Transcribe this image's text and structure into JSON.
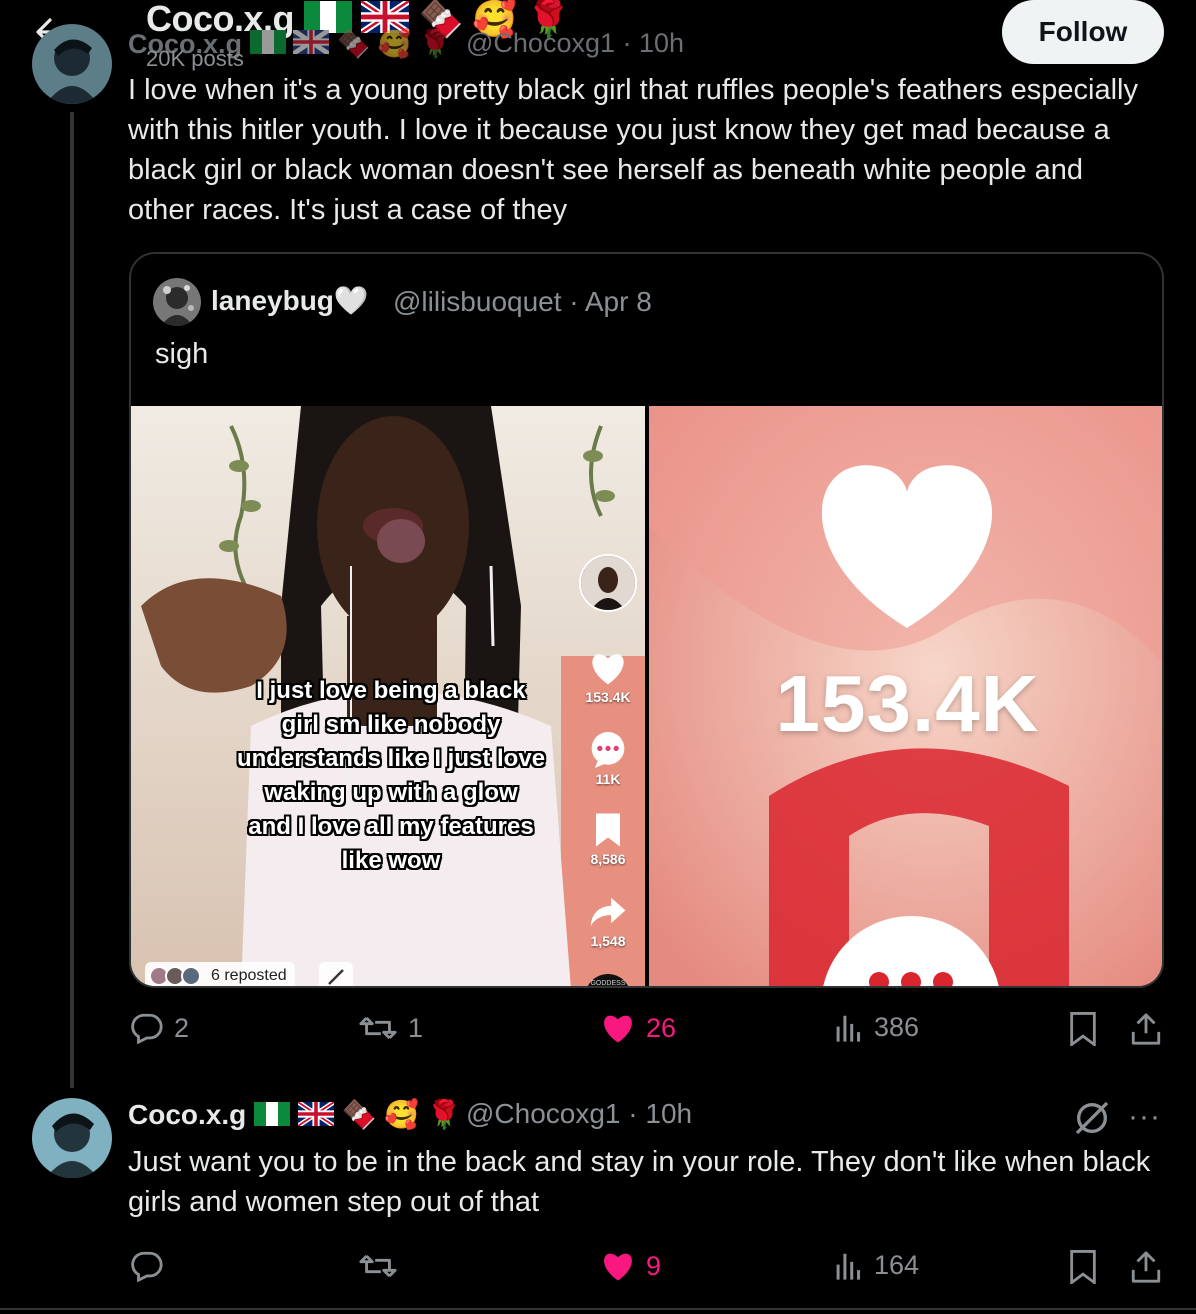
{
  "header": {
    "back_icon": "arrow-left-icon",
    "title": "Coco.x.g",
    "post_count": "20K posts",
    "follow_label": "Follow"
  },
  "emoji": {
    "chocolate": "🍫",
    "face": "🥰",
    "rose": "🌹",
    "heart_white": "🤍"
  },
  "tweet1": {
    "name": "Coco.x.g",
    "handle_time": "@Chocoxg1 · 10h",
    "text": "I love when it's a young pretty black girl that ruffles people's feathers especially with this hitler youth. I love it because you just know they get mad because a black girl or black woman doesn't see herself as beneath white people and other races. It's just a case of they",
    "quote": {
      "name": "laneybug",
      "handle_time": "@lilisbuoquet · Apr 8",
      "text": "sigh",
      "media_left": {
        "caption_lines": [
          "I just love being a black",
          "girl sm like nobody",
          "understands like I just love",
          "waking up with a glow",
          "and I love all my features",
          "like wow"
        ],
        "likes": "153.4K",
        "comments": "11K",
        "saves": "8,586",
        "shares": "1,548",
        "reposted": "6 reposted",
        "sound_label": "GODDESS"
      },
      "media_right": {
        "likes": "153.4K"
      }
    },
    "actions": {
      "replies": "2",
      "reposts": "1",
      "likes": "26",
      "views": "386"
    }
  },
  "tweet2": {
    "name": "Coco.x.g",
    "handle_time": "@Chocoxg1 · 10h",
    "text": "Just want you to be in the back and stay in your role. They don't like when black girls and women step out of that",
    "more": "···",
    "actions": {
      "replies": "",
      "reposts": "",
      "likes": "9",
      "views": "164"
    }
  },
  "colors": {
    "like_pink": "#f91880",
    "muted": "#8b9095",
    "text": "#e7e9ea",
    "border": "#2f3336"
  }
}
